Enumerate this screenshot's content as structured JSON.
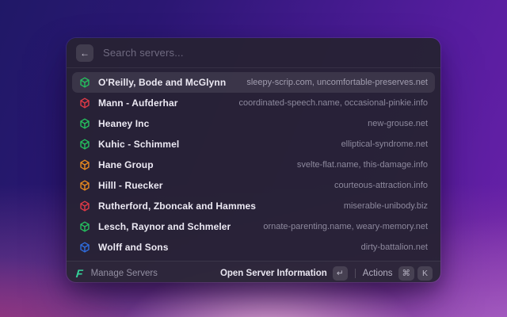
{
  "window": {
    "search": {
      "placeholder": "Search servers...",
      "back_icon": "←"
    },
    "list": {
      "rows": [
        {
          "name": "O'Reilly, Bode and McGlynn",
          "domains": "sleepy-scrip.com, uncomfortable-preserves.net",
          "icon": "cube-icon",
          "icon_color": "#25c05f",
          "selected": true
        },
        {
          "name": "Mann - Aufderhar",
          "domains": "coordinated-speech.name, occasional-pinkie.info",
          "icon": "cube-icon",
          "icon_color": "#e03a47",
          "selected": false
        },
        {
          "name": "Heaney Inc",
          "domains": "new-grouse.net",
          "icon": "cube-icon",
          "icon_color": "#25c05f",
          "selected": false
        },
        {
          "name": "Kuhic - Schimmel",
          "domains": "elliptical-syndrome.net",
          "icon": "cube-icon",
          "icon_color": "#25c05f",
          "selected": false
        },
        {
          "name": "Hane Group",
          "domains": "svelte-flat.name, this-damage.info",
          "icon": "cube-icon",
          "icon_color": "#e8891f",
          "selected": false
        },
        {
          "name": "Hilll - Ruecker",
          "domains": "courteous-attraction.info",
          "icon": "cube-icon",
          "icon_color": "#e8891f",
          "selected": false
        },
        {
          "name": "Rutherford, Zboncak and Hammes",
          "domains": "miserable-unibody.biz",
          "icon": "cube-icon",
          "icon_color": "#e03a47",
          "selected": false
        },
        {
          "name": "Lesch, Raynor and Schmeler",
          "domains": "ornate-parenting.name, weary-memory.net",
          "icon": "cube-icon",
          "icon_color": "#25c05f",
          "selected": false
        },
        {
          "name": "Wolff and Sons",
          "domains": "dirty-battalion.net",
          "icon": "cube-icon",
          "icon_color": "#2f6de0",
          "selected": false
        }
      ]
    },
    "footer": {
      "logo_glyph": "F",
      "app_name": "Manage Servers",
      "primary_action": "Open Server Information",
      "primary_key": "↵",
      "secondary_action": "Actions",
      "secondary_keys": [
        "⌘",
        "K"
      ]
    },
    "colors": {
      "window_bg": "#272235",
      "selected_row": "rgba(255,255,255,0.09)",
      "logo_green": "#34d399",
      "icon_green": "#25c05f",
      "icon_red": "#e03a47",
      "icon_orange": "#e8891f",
      "icon_blue": "#2f6de0"
    }
  }
}
